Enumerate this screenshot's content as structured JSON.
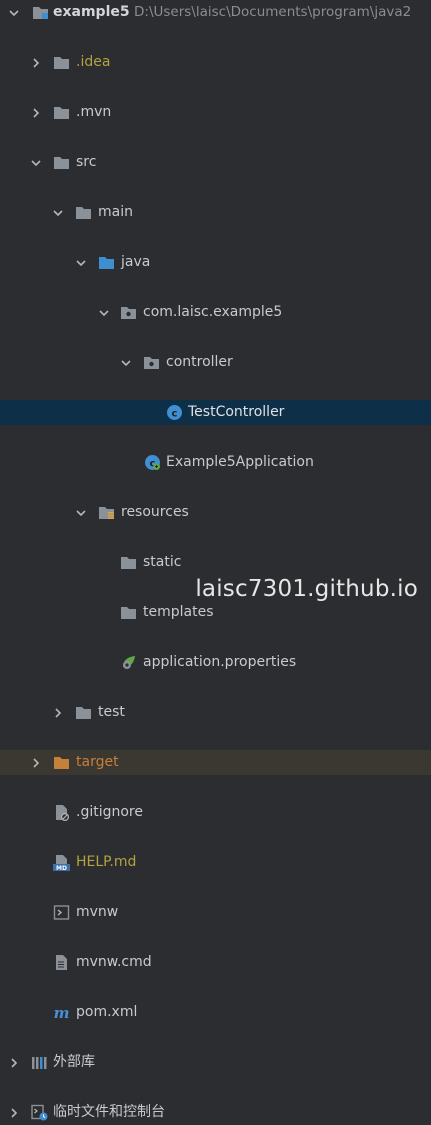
{
  "tree": {
    "root": {
      "label": "example5",
      "path": "D:\\Users\\laisc\\Documents\\program\\java2"
    },
    "idea": "idea",
    "idea_dot": ".",
    "mvn": ".mvn",
    "src": "src",
    "main": "main",
    "java": "java",
    "package": "com.laisc.example5",
    "controller": "controller",
    "test_controller": "TestController",
    "application": "Example5Application",
    "resources": "resources",
    "static": "static",
    "templates": "templates",
    "app_properties": "application.properties",
    "test": "test",
    "target": "target",
    "gitignore": ".gitignore",
    "help": "HELP.md",
    "mvnw": "mvnw",
    "mvnw_cmd": "mvnw.cmd",
    "pom": "pom.xml",
    "external_libs": "外部库",
    "scratches": "临时文件和控制台"
  },
  "colors": {
    "background": "#2b2d30",
    "selected": "#0e2f48",
    "excluded": "#3a3830",
    "folder": "#8b9198",
    "java_folder": "#3d8fd1",
    "orange_folder": "#c5803b"
  },
  "watermark": "laisc7301.github.io"
}
